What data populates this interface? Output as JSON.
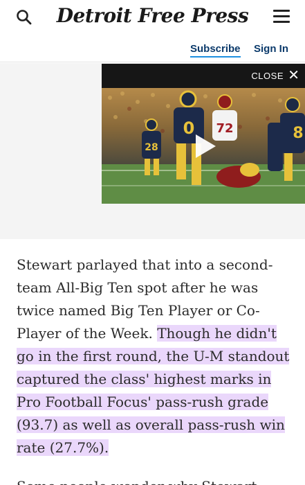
{
  "header": {
    "logo_text": "Detroit Free Press",
    "subscribe_label": "Subscribe",
    "signin_label": "Sign In"
  },
  "video_player": {
    "close_label": "CLOSE",
    "close_symbol": "✕",
    "jersey_numbers": [
      "28",
      "0",
      "72",
      "8"
    ]
  },
  "article": {
    "plain_text": "Stewart parlayed that into a second-team All-Big Ten spot after he was twice named Big Ten Player or Co-Player of the Week. ",
    "highlighted_text": "Though he didn't go in the first round, the U-M standout captured the class' highest marks in Pro Football Focus' pass-rush grade (93.7) as well as overall pass-rush win rate (27.7%).",
    "next_paragraph_partial": "Some people wonder why Stewart would be"
  },
  "colors": {
    "highlight": "#ead7fb",
    "link_blue": "#0b3a6b",
    "underline_blue": "#1d8fe0"
  }
}
